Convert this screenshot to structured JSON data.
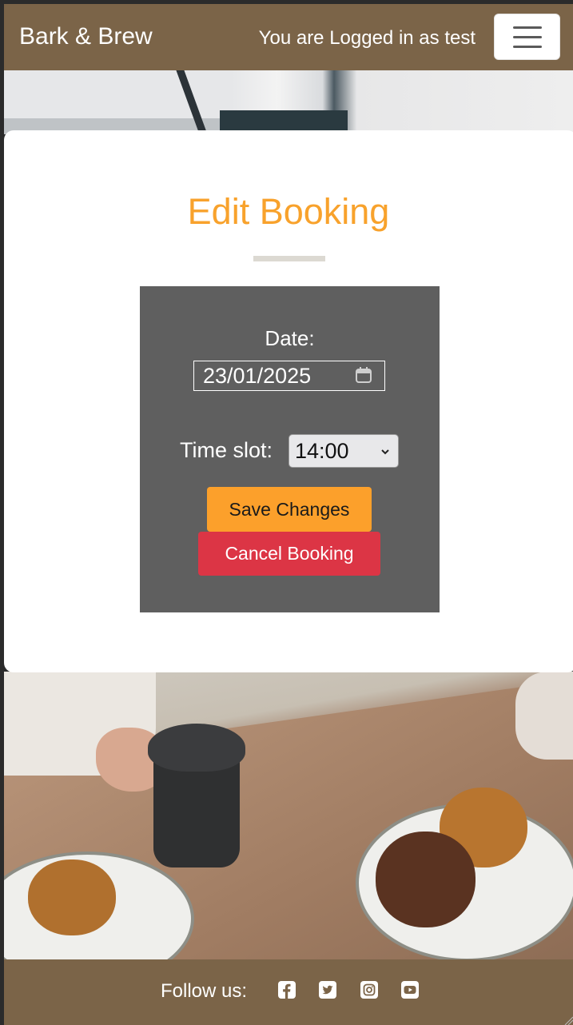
{
  "navbar": {
    "brand": "Bark & Brew",
    "login_status": "You are Logged in as test",
    "menu_icon": "hamburger-menu-icon"
  },
  "card": {
    "title": "Edit Booking"
  },
  "form": {
    "date_label": "Date:",
    "date_value": "23/01/2025",
    "time_label": "Time slot:",
    "time_value": "14:00",
    "save_label": "Save Changes",
    "cancel_label": "Cancel Booking"
  },
  "footer": {
    "follow_label": "Follow us:",
    "social_icons": [
      "facebook-icon",
      "twitter-icon",
      "instagram-icon",
      "youtube-icon"
    ]
  },
  "colors": {
    "brand_brown": "#7b6448",
    "title_orange": "#f8a22c",
    "save_orange": "#fca02b",
    "cancel_red": "#dc3545",
    "form_grey": "#5f5f5f"
  }
}
